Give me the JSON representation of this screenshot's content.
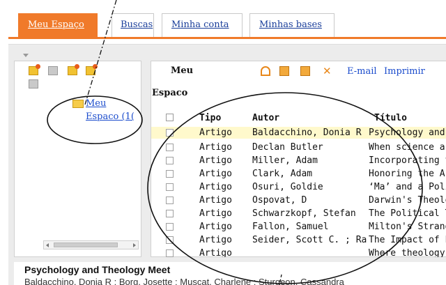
{
  "tabs": [
    {
      "label": "Meu Espaço",
      "active": true
    },
    {
      "label": "Buscas",
      "active": false
    },
    {
      "label": "Minha conta",
      "active": false
    },
    {
      "label": "Minhas bases",
      "active": false
    }
  ],
  "tree": {
    "folder_line1": "Meu",
    "folder_line2": "Espaco (1("
  },
  "content": {
    "folder_title_line1": "Meu",
    "folder_title_line2": "Espaco",
    "toolbar": {
      "email_label": "E-mail",
      "print_label": "Imprimir"
    },
    "columns": [
      "Tipo",
      "Autor",
      "Título"
    ],
    "rows": [
      {
        "tipo": "Artigo",
        "autor": "Baldacchino, Donia R ...",
        "titulo": "Psychology and",
        "selected": true
      },
      {
        "tipo": "Artigo",
        "autor": "Declan Butler",
        "titulo": "When science a",
        "selected": false
      },
      {
        "tipo": "Artigo",
        "autor": "Miller, Adam",
        "titulo": "Incorporating th",
        "selected": false
      },
      {
        "tipo": "Artigo",
        "autor": "Clark, Adam",
        "titulo": "Honoring the Ar",
        "selected": false
      },
      {
        "tipo": "Artigo",
        "autor": "Osuri, Goldie",
        "titulo": "‘Ma’ and a Polit",
        "selected": false
      },
      {
        "tipo": "Artigo",
        "autor": "Ospovat, D",
        "titulo": "Darwin's Theolo",
        "selected": false
      },
      {
        "tipo": "Artigo",
        "autor": "Schwarzkopf, Stefan",
        "titulo": "The Political Th",
        "selected": false
      },
      {
        "tipo": "Artigo",
        "autor": "Fallon, Samuel",
        "titulo": "Milton's Strange",
        "selected": false
      },
      {
        "tipo": "Artigo",
        "autor": "Seider, Scott C. ; Rab...",
        "titulo": "The Impact of P",
        "selected": false
      },
      {
        "tipo": "Artigo",
        "autor": "",
        "titulo": "Where theology",
        "selected": false
      }
    ]
  },
  "preview": {
    "title": "Psychology and Theology Meet",
    "authors": "Baldacchino, Donia R ; Borg, Josette ; Muscat, Charlene ; Sturgeon, Cassandra"
  },
  "colors": {
    "accent_orange": "#f07a2a",
    "link_blue": "#1a4bcc",
    "selected_row": "#fff9cc"
  }
}
